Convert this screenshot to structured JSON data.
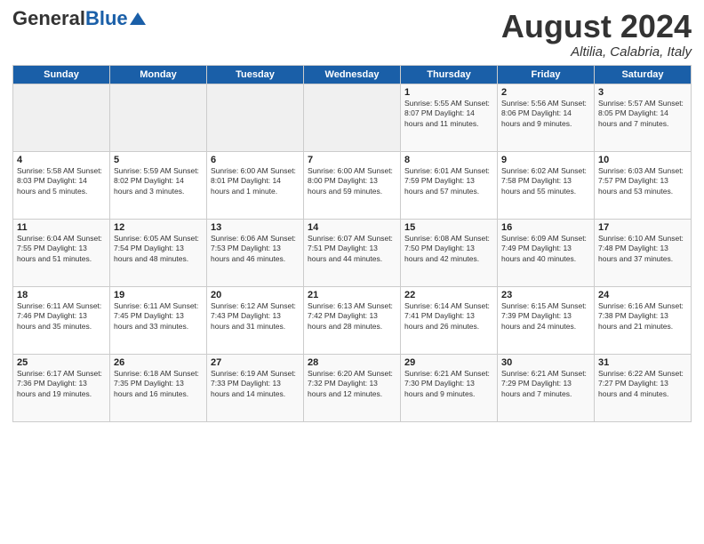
{
  "header": {
    "logo_general": "General",
    "logo_blue": "Blue",
    "month_title": "August 2024",
    "location": "Altilia, Calabria, Italy"
  },
  "days_of_week": [
    "Sunday",
    "Monday",
    "Tuesday",
    "Wednesday",
    "Thursday",
    "Friday",
    "Saturday"
  ],
  "weeks": [
    [
      {
        "day": "",
        "detail": ""
      },
      {
        "day": "",
        "detail": ""
      },
      {
        "day": "",
        "detail": ""
      },
      {
        "day": "",
        "detail": ""
      },
      {
        "day": "1",
        "detail": "Sunrise: 5:55 AM\nSunset: 8:07 PM\nDaylight: 14 hours\nand 11 minutes."
      },
      {
        "day": "2",
        "detail": "Sunrise: 5:56 AM\nSunset: 8:06 PM\nDaylight: 14 hours\nand 9 minutes."
      },
      {
        "day": "3",
        "detail": "Sunrise: 5:57 AM\nSunset: 8:05 PM\nDaylight: 14 hours\nand 7 minutes."
      }
    ],
    [
      {
        "day": "4",
        "detail": "Sunrise: 5:58 AM\nSunset: 8:03 PM\nDaylight: 14 hours\nand 5 minutes."
      },
      {
        "day": "5",
        "detail": "Sunrise: 5:59 AM\nSunset: 8:02 PM\nDaylight: 14 hours\nand 3 minutes."
      },
      {
        "day": "6",
        "detail": "Sunrise: 6:00 AM\nSunset: 8:01 PM\nDaylight: 14 hours\nand 1 minute."
      },
      {
        "day": "7",
        "detail": "Sunrise: 6:00 AM\nSunset: 8:00 PM\nDaylight: 13 hours\nand 59 minutes."
      },
      {
        "day": "8",
        "detail": "Sunrise: 6:01 AM\nSunset: 7:59 PM\nDaylight: 13 hours\nand 57 minutes."
      },
      {
        "day": "9",
        "detail": "Sunrise: 6:02 AM\nSunset: 7:58 PM\nDaylight: 13 hours\nand 55 minutes."
      },
      {
        "day": "10",
        "detail": "Sunrise: 6:03 AM\nSunset: 7:57 PM\nDaylight: 13 hours\nand 53 minutes."
      }
    ],
    [
      {
        "day": "11",
        "detail": "Sunrise: 6:04 AM\nSunset: 7:55 PM\nDaylight: 13 hours\nand 51 minutes."
      },
      {
        "day": "12",
        "detail": "Sunrise: 6:05 AM\nSunset: 7:54 PM\nDaylight: 13 hours\nand 48 minutes."
      },
      {
        "day": "13",
        "detail": "Sunrise: 6:06 AM\nSunset: 7:53 PM\nDaylight: 13 hours\nand 46 minutes."
      },
      {
        "day": "14",
        "detail": "Sunrise: 6:07 AM\nSunset: 7:51 PM\nDaylight: 13 hours\nand 44 minutes."
      },
      {
        "day": "15",
        "detail": "Sunrise: 6:08 AM\nSunset: 7:50 PM\nDaylight: 13 hours\nand 42 minutes."
      },
      {
        "day": "16",
        "detail": "Sunrise: 6:09 AM\nSunset: 7:49 PM\nDaylight: 13 hours\nand 40 minutes."
      },
      {
        "day": "17",
        "detail": "Sunrise: 6:10 AM\nSunset: 7:48 PM\nDaylight: 13 hours\nand 37 minutes."
      }
    ],
    [
      {
        "day": "18",
        "detail": "Sunrise: 6:11 AM\nSunset: 7:46 PM\nDaylight: 13 hours\nand 35 minutes."
      },
      {
        "day": "19",
        "detail": "Sunrise: 6:11 AM\nSunset: 7:45 PM\nDaylight: 13 hours\nand 33 minutes."
      },
      {
        "day": "20",
        "detail": "Sunrise: 6:12 AM\nSunset: 7:43 PM\nDaylight: 13 hours\nand 31 minutes."
      },
      {
        "day": "21",
        "detail": "Sunrise: 6:13 AM\nSunset: 7:42 PM\nDaylight: 13 hours\nand 28 minutes."
      },
      {
        "day": "22",
        "detail": "Sunrise: 6:14 AM\nSunset: 7:41 PM\nDaylight: 13 hours\nand 26 minutes."
      },
      {
        "day": "23",
        "detail": "Sunrise: 6:15 AM\nSunset: 7:39 PM\nDaylight: 13 hours\nand 24 minutes."
      },
      {
        "day": "24",
        "detail": "Sunrise: 6:16 AM\nSunset: 7:38 PM\nDaylight: 13 hours\nand 21 minutes."
      }
    ],
    [
      {
        "day": "25",
        "detail": "Sunrise: 6:17 AM\nSunset: 7:36 PM\nDaylight: 13 hours\nand 19 minutes."
      },
      {
        "day": "26",
        "detail": "Sunrise: 6:18 AM\nSunset: 7:35 PM\nDaylight: 13 hours\nand 16 minutes."
      },
      {
        "day": "27",
        "detail": "Sunrise: 6:19 AM\nSunset: 7:33 PM\nDaylight: 13 hours\nand 14 minutes."
      },
      {
        "day": "28",
        "detail": "Sunrise: 6:20 AM\nSunset: 7:32 PM\nDaylight: 13 hours\nand 12 minutes."
      },
      {
        "day": "29",
        "detail": "Sunrise: 6:21 AM\nSunset: 7:30 PM\nDaylight: 13 hours\nand 9 minutes."
      },
      {
        "day": "30",
        "detail": "Sunrise: 6:21 AM\nSunset: 7:29 PM\nDaylight: 13 hours\nand 7 minutes."
      },
      {
        "day": "31",
        "detail": "Sunrise: 6:22 AM\nSunset: 7:27 PM\nDaylight: 13 hours\nand 4 minutes."
      }
    ]
  ]
}
